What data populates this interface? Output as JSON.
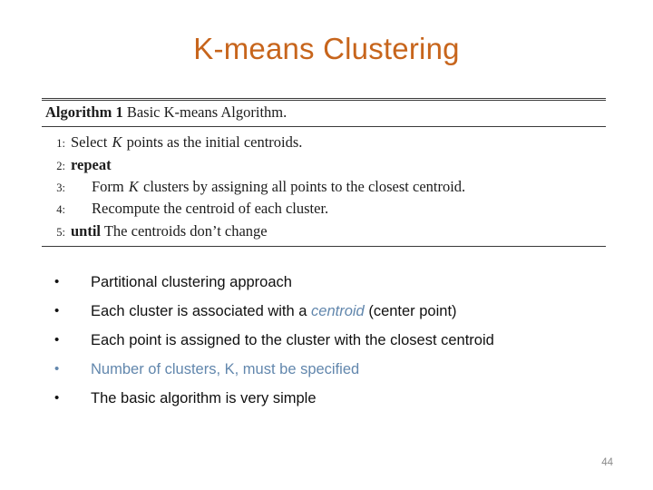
{
  "slide": {
    "title": "K-means Clustering",
    "title_color": "#c7651c",
    "page_number": "44",
    "background": "#ffffff"
  },
  "algorithm": {
    "header": {
      "keyword": "Algorithm 1",
      "caption": "Basic K-means Algorithm."
    },
    "lines": [
      {
        "number": "1:",
        "indent": false,
        "pre_keyword": "",
        "text_a": "Select ",
        "math": "K",
        "text_b": " points as the initial centroids."
      },
      {
        "number": "2:",
        "indent": false,
        "pre_keyword": "repeat",
        "text_a": "",
        "math": "",
        "text_b": ""
      },
      {
        "number": "3:",
        "indent": true,
        "pre_keyword": "",
        "text_a": "Form ",
        "math": "K",
        "text_b": " clusters by assigning all points to the closest centroid."
      },
      {
        "number": "4:",
        "indent": true,
        "pre_keyword": "",
        "text_a": "Recompute the centroid of each cluster.",
        "math": "",
        "text_b": ""
      },
      {
        "number": "5:",
        "indent": false,
        "pre_keyword": "until",
        "text_a": "",
        "math": "",
        "text_b": " The centroids don’t change"
      }
    ]
  },
  "bullets": {
    "marker": "•",
    "accent_color": "#6287ad",
    "items": [
      {
        "marker": "•",
        "marker_blue": false,
        "justify": false,
        "text_a": "Partitional clustering approach",
        "emphasis": "",
        "text_b": ""
      },
      {
        "marker": "•",
        "marker_blue": false,
        "justify": false,
        "text_a": "Each cluster is associated with a ",
        "emphasis": "centroid",
        "text_b": " (center point)"
      },
      {
        "marker": "•",
        "marker_blue": false,
        "justify": true,
        "text_a": "Each point is assigned to the cluster with the closest centroid",
        "emphasis": "",
        "text_b": ""
      },
      {
        "marker": "•",
        "marker_blue": true,
        "justify": false,
        "text_a": "",
        "emphasis": "Number of clusters, K, must be specified",
        "text_b": ""
      },
      {
        "marker": "•",
        "marker_blue": false,
        "justify": false,
        "text_a": "The basic algorithm is very simple",
        "emphasis": "",
        "text_b": ""
      }
    ]
  }
}
